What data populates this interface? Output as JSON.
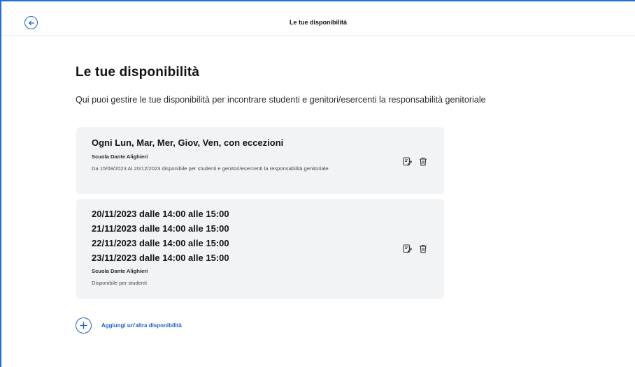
{
  "colors": {
    "accent": "#1f5fc7",
    "frame": "#1f6fd6",
    "card_bg": "#f2f3f5"
  },
  "topbar": {
    "title": "Le tue disponibilità",
    "back_icon": "arrow-left-circle-icon"
  },
  "main": {
    "title": "Le tue disponibilità",
    "description": "Qui puoi gestire le tue disponibilità per incontrare studenti e genitori/esercenti la responsabilità genitoriale"
  },
  "cards": [
    {
      "heading": "Ogni Lun, Mar, Mer, Giov, Ven, con eccezioni",
      "school": "Scuola Dante Alighieri",
      "note": "Da 15/09/2023 Al 20/12/2023 disponibile per studenti e genitori/esercenti la responsabilità genitoriale",
      "edit_icon": "edit-icon",
      "delete_icon": "trash-icon"
    },
    {
      "lines": [
        "20/11/2023 dalle 14:00 alle 15:00",
        "21/11/2023 dalle 14:00 alle 15:00",
        "22/11/2023 dalle 14:00 alle 15:00",
        "23/11/2023 dalle 14:00 alle 15:00"
      ],
      "school": "Scuola Dante Alighieri",
      "note": "Disponibile per studenti",
      "edit_icon": "edit-icon",
      "delete_icon": "trash-icon"
    }
  ],
  "add": {
    "label": "Aggiungi un'altra disponibilità",
    "icon": "plus-circle-icon"
  }
}
